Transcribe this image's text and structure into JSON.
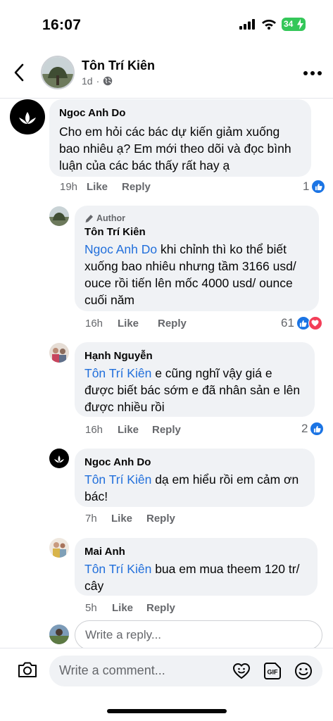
{
  "status": {
    "time": "16:07",
    "battery": "34"
  },
  "header": {
    "name": "Tôn Trí Kiên",
    "age": "1d"
  },
  "comments": [
    {
      "name": "Ngoc Anh Do",
      "text": "Cho em hỏi các bác dự kiến giảm xuống bao nhiêu ạ? Em mới theo dõi và đọc bình luận của các bác thấy rất  hay ạ",
      "time": "19h",
      "like": "Like",
      "reply": "Reply",
      "reaction_count": "1"
    },
    {
      "author_label": "Author",
      "name": "Tôn Trí Kiên",
      "mention": "Ngoc Anh Do",
      "text": " khi chỉnh thì ko thể biết xuống bao nhiêu nhưng tầm 3166 usd/ ouce rồi tiến lên mốc 4000 usd/ ounce cuối năm",
      "time": "16h",
      "like": "Like",
      "reply": "Reply",
      "reaction_count": "61"
    },
    {
      "name": "Hạnh Nguyễn",
      "mention": "Tôn Trí Kiên",
      "text": " e cũng nghĩ vậy giá e được biết bác sớm e đã nhân sản e lên được nhiều rồi",
      "time": "16h",
      "like": "Like",
      "reply": "Reply",
      "reaction_count": "2"
    },
    {
      "name": "Ngoc Anh Do",
      "mention": "Tôn Trí Kiên",
      "text": " dạ em hiểu rồi em cảm ơn bác!",
      "time": "7h",
      "like": "Like",
      "reply": "Reply"
    },
    {
      "name": "Mai Anh",
      "mention": "Tôn Trí Kiên",
      "text": " bua em mua theem 120 tr/ cây",
      "time": "5h",
      "like": "Like",
      "reply": "Reply"
    }
  ],
  "reply_input": {
    "placeholder": "Write a reply..."
  },
  "comment_input": {
    "placeholder": "Write a comment..."
  },
  "icons": [
    "back-arrow-icon",
    "globe-icon",
    "more-icon",
    "pen-icon",
    "like-reaction-icon",
    "love-reaction-icon",
    "camera-icon",
    "avatar-sticker-icon",
    "gif-icon",
    "emoji-icon"
  ],
  "colors": {
    "mention": "#216fdb",
    "like_blue": "#1b74e4",
    "love_red": "#f33e58",
    "bubble": "#f0f2f5",
    "battery": "#34c759"
  }
}
